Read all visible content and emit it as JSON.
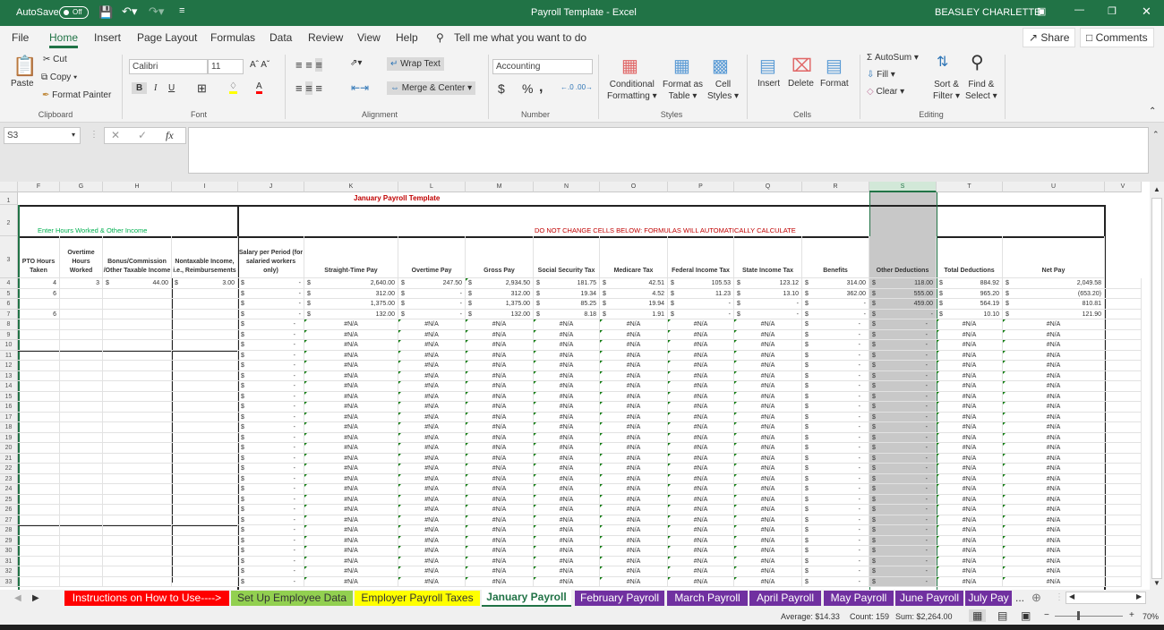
{
  "titlebar": {
    "autosave_label": "AutoSave",
    "autosave_state": "Off",
    "title": "Payroll Template  -  Excel",
    "user": "BEASLEY CHARLETTE"
  },
  "menu": {
    "items": [
      "File",
      "Home",
      "Insert",
      "Page Layout",
      "Formulas",
      "Data",
      "Review",
      "View",
      "Help"
    ],
    "active": "Home",
    "tell_me": "Tell me what you want to do",
    "share": "Share",
    "comments": "Comments"
  },
  "ribbon": {
    "clipboard": {
      "paste": "Paste",
      "cut": "Cut",
      "copy": "Copy",
      "format_painter": "Format Painter",
      "label": "Clipboard"
    },
    "font": {
      "name": "Calibri",
      "size": "11",
      "label": "Font",
      "bold": "B",
      "italic": "I",
      "underline": "U"
    },
    "alignment": {
      "wrap_text": "Wrap Text",
      "merge_center": "Merge & Center",
      "label": "Alignment"
    },
    "number": {
      "format": "Accounting",
      "currency": "$",
      "percent": "%",
      "comma": ",",
      "label": "Number"
    },
    "styles": {
      "conditional_1": "Conditional",
      "conditional_2": "Formatting",
      "format_table_1": "Format as",
      "format_table_2": "Table",
      "cell_styles_1": "Cell",
      "cell_styles_2": "Styles",
      "label": "Styles"
    },
    "cells": {
      "insert": "Insert",
      "delete": "Delete",
      "format": "Format",
      "label": "Cells"
    },
    "editing": {
      "autosum": "AutoSum",
      "fill": "Fill",
      "clear": "Clear",
      "sort_1": "Sort &",
      "sort_2": "Filter",
      "find_1": "Find &",
      "find_2": "Select",
      "label": "Editing"
    }
  },
  "formula_bar": {
    "name_box": "S3",
    "formula": "",
    "fx": "fx"
  },
  "columns": [
    "F",
    "G",
    "H",
    "I",
    "J",
    "K",
    "L",
    "M",
    "N",
    "O",
    "P",
    "Q",
    "R",
    "S",
    "T",
    "U",
    "V"
  ],
  "selected_column": "S",
  "sheet": {
    "title": "January Payroll Template",
    "enter_label": "Enter Hours Worked & Other Income",
    "warning": "DO NOT CHANGE CELLS BELOW: FORMULAS WILL AUTOMATICALLY CALCULATE",
    "headers": [
      "PTO Hours Taken",
      "Overtime Hours Worked",
      "Bonus/Commission /Other Taxable Income",
      "Nontaxable Income, i.e., Reimbursements",
      "Salary per Period (for salaried workers only)",
      "Straight-Time Pay",
      "Overtime Pay",
      "Gross Pay",
      "Social Security Tax",
      "Medicare Tax",
      "Federal Income Tax",
      "State Income Tax",
      "Benefits",
      "Other Deductions",
      "Total Deductions",
      "Net Pay"
    ],
    "rows": [
      {
        "row": 4,
        "F": "4",
        "G": "3",
        "H": "44.00",
        "I": "3.00",
        "J": "-",
        "K": "2,640.00",
        "L": "247.50",
        "M": "2,934.50",
        "N": "181.75",
        "O": "42.51",
        "P": "105.53",
        "Q": "123.12",
        "R": "314.00",
        "S": "118.00",
        "T": "884.92",
        "U": "2,049.58"
      },
      {
        "row": 5,
        "F": "6",
        "G": "",
        "H": "",
        "I": "",
        "J": "-",
        "K": "312.00",
        "L": "-",
        "M": "312.00",
        "N": "19.34",
        "O": "4.52",
        "P": "11.23",
        "Q": "13.10",
        "R": "362.00",
        "S": "555.00",
        "T": "965.20",
        "U": "(653.20)"
      },
      {
        "row": 6,
        "F": "",
        "G": "",
        "H": "",
        "I": "",
        "J": "-",
        "K": "1,375.00",
        "L": "-",
        "M": "1,375.00",
        "N": "85.25",
        "O": "19.94",
        "P": "-",
        "Q": "-",
        "R": "-",
        "S": "459.00",
        "T": "564.19",
        "U": "810.81"
      },
      {
        "row": 7,
        "F": "6",
        "G": "",
        "H": "",
        "I": "",
        "J": "-",
        "K": "132.00",
        "L": "-",
        "M": "132.00",
        "N": "8.18",
        "O": "1.91",
        "P": "-",
        "Q": "-",
        "R": "-",
        "S": "-",
        "T": "10.10",
        "U": "121.90"
      }
    ],
    "na_value": "#N/A",
    "dash_value": "-",
    "currency": "$",
    "na_rows_from": 8,
    "na_rows_to": 33
  },
  "tabs": [
    {
      "label": "Instructions on How to Use---->",
      "bg": "#ff0000",
      "fg": "#ffffff"
    },
    {
      "label": "Set Up Employee Data",
      "bg": "#92d050",
      "fg": "#333333"
    },
    {
      "label": "Employer Payroll Taxes",
      "bg": "#ffff00",
      "fg": "#333333"
    },
    {
      "label": "January Payroll",
      "bg": "#ffffff",
      "fg": "#217346",
      "active": true
    },
    {
      "label": "February Payroll",
      "bg": "#7030a0",
      "fg": "#ffffff"
    },
    {
      "label": "March Payroll",
      "bg": "#7030a0",
      "fg": "#ffffff"
    },
    {
      "label": "April Payroll",
      "bg": "#7030a0",
      "fg": "#ffffff"
    },
    {
      "label": "May Payroll",
      "bg": "#7030a0",
      "fg": "#ffffff"
    },
    {
      "label": "June Payroll",
      "bg": "#7030a0",
      "fg": "#ffffff"
    },
    {
      "label": "July Pay",
      "bg": "#7030a0",
      "fg": "#ffffff"
    }
  ],
  "tabs_more": "...",
  "status": {
    "average": "Average: $14.33",
    "count": "Count: 159",
    "sum": "Sum: $2,264.00",
    "zoom": "70%"
  },
  "colors": {
    "brand": "#217346",
    "title_red": "#c00000",
    "enter_green": "#00b050",
    "selected_gray": "#c8c8c8"
  }
}
